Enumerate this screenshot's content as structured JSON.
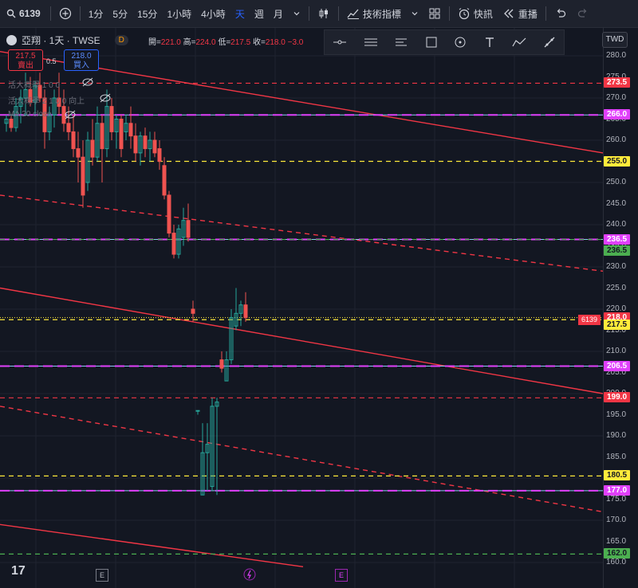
{
  "toolbar": {
    "symbol": "6139",
    "intervals": [
      "1分",
      "5分",
      "15分",
      "1小時",
      "4小時",
      "週",
      "月"
    ],
    "active_interval": "天",
    "indicators_label": "技術指標",
    "quick_order_label": "快訊",
    "replay_label": "重播"
  },
  "legend": {
    "name": "亞翔 · 1天 · TWSE",
    "badge": "D",
    "open_label": "開",
    "open": "221.0",
    "high_label": "高",
    "high": "224.0",
    "low_label": "低",
    "low": "217.5",
    "close_label": "收",
    "close": "218.0",
    "change": "−3.0"
  },
  "trade": {
    "sell_price": "217.5",
    "sell_label": "賣出",
    "buy_price": "218.0",
    "buy_label": "買入",
    "spread": "0.5"
  },
  "indicators": [
    "活大概學 1 0 0",
    "活大概學 2 1 0 0 向上",
    "MA 20 close"
  ],
  "currency": "TWD",
  "price_axis": {
    "ticks": [
      "280.0",
      "275.0",
      "270.0",
      "265.0",
      "260.0",
      "255.0",
      "250.0",
      "245.0",
      "240.0",
      "235.0",
      "230.0",
      "225.0",
      "220.0",
      "215.0",
      "210.0",
      "205.0",
      "200.0",
      "195.0",
      "190.0",
      "185.0",
      "180.0",
      "175.0",
      "170.0",
      "165.0",
      "160.0"
    ]
  },
  "levels": [
    {
      "price": "273.5",
      "color": "#f23645"
    },
    {
      "price": "266.0",
      "color": "#e040fb"
    },
    {
      "price": "255.0",
      "color": "#ffeb3b"
    },
    {
      "price": "236.5",
      "color": "#e040fb"
    },
    {
      "price": "236.5",
      "color": "#4caf50"
    },
    {
      "price": "218.0",
      "color": "#f23645"
    },
    {
      "price": "217.5",
      "color": "#ffeb3b"
    },
    {
      "price": "206.5",
      "color": "#e040fb"
    },
    {
      "price": "199.0",
      "color": "#f23645"
    },
    {
      "price": "180.5",
      "color": "#ffeb3b"
    },
    {
      "price": "177.0",
      "color": "#e040fb"
    },
    {
      "price": "162.0",
      "color": "#4caf50"
    }
  ],
  "current_symbol_tag": "6139",
  "bottom_marks": [
    "E",
    "E"
  ],
  "colors": {
    "up": "#26a69a",
    "down": "#ef5350",
    "bg": "#131722"
  }
}
